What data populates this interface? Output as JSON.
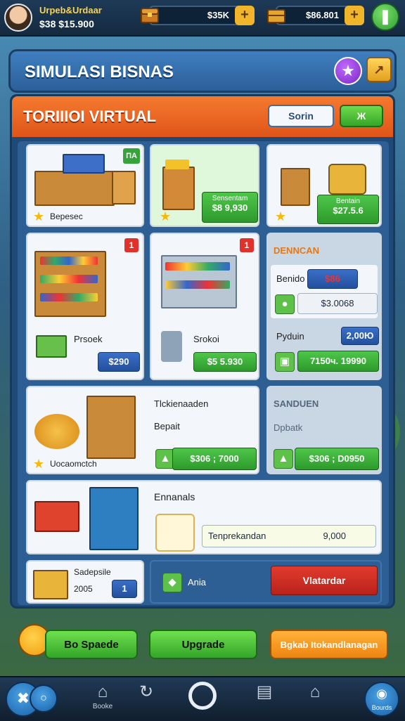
{
  "top_bar": {
    "player_name": "Urpeb&Urdaar",
    "player_balance": "$38 $15.900",
    "resource_1": "$35K",
    "resource_2": "$86.801",
    "plus_label": "+"
  },
  "title_panel": {
    "title": "SIMULASI BISNAS"
  },
  "store_panel": {
    "header": "TORIIIOI VIRTUAL",
    "sort_label": "Sorin",
    "filter_label": "Ж"
  },
  "cards": {
    "c1": {
      "label": "Bepesec",
      "badge": "ПА"
    },
    "c2": {
      "label": "Sensentam",
      "price": "$8 9,930"
    },
    "c3": {
      "label": "Bentain",
      "price": "$27.5.6"
    },
    "c4": {
      "label": "Prsoek",
      "badge": "1",
      "price": "$290"
    },
    "c5": {
      "label": "Srokoi",
      "badge": "1",
      "price": "$5 5.930"
    },
    "c6": {
      "header": "DENNCAN",
      "row1_label": "Benido",
      "row1_value": "$86",
      "row2_value": "$3.0068",
      "row3_label": "Pyduin",
      "row3_value": "2,00Ю",
      "row4_value": "7150ч. 19990"
    },
    "c7": {
      "title": "Tlckienaaden",
      "sub": "Bepait",
      "label": "Uocaomctch",
      "price": "$306 ; 7000"
    },
    "c8": {
      "header": "SANDUEN",
      "sub": "Dpbatk",
      "price": "$306 ; D0950"
    },
    "c9": {
      "title": "Ennanals",
      "field_label": "Tenprekandan",
      "field_value": "9,000"
    },
    "c10": {
      "label": "Sadepsile",
      "value": "2005",
      "badge": "1"
    },
    "c11": {
      "label": "Ania",
      "button": "Vlatardar"
    }
  },
  "bottom_buttons": {
    "b1": "Bo Spaede",
    "b2": "Upgrade",
    "b3": "Bgkab Itokandlanagan"
  },
  "nav": {
    "home": "Booke",
    "center": "",
    "right": "Bourds"
  }
}
